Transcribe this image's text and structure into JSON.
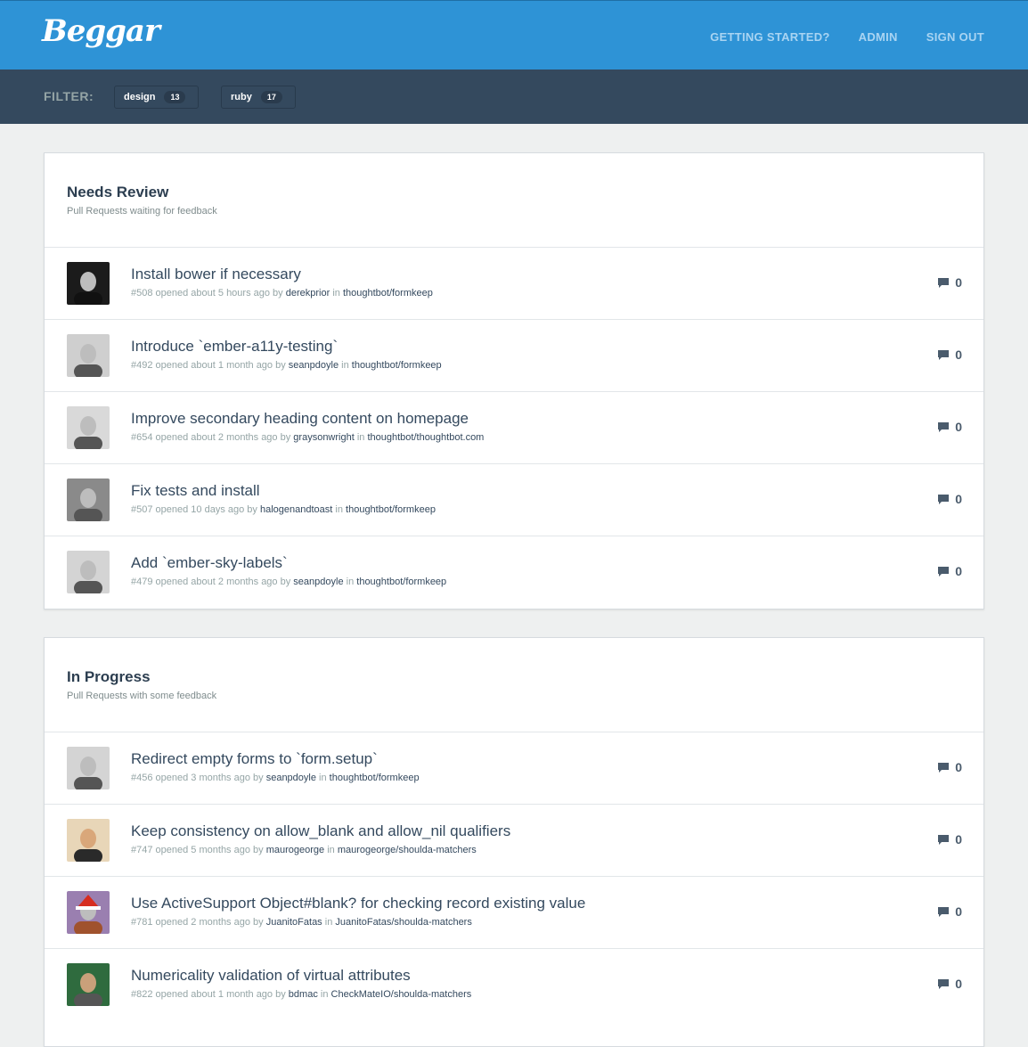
{
  "header": {
    "logo": "Beggar",
    "nav": [
      "GETTING STARTED?",
      "ADMIN",
      "SIGN OUT"
    ]
  },
  "filter": {
    "label": "FILTER:",
    "tags": [
      {
        "name": "design",
        "count": "13"
      },
      {
        "name": "ruby",
        "count": "17"
      }
    ]
  },
  "sections": [
    {
      "title": "Needs Review",
      "subtitle": "Pull Requests waiting for feedback",
      "items": [
        {
          "title": "Install bower if necessary",
          "number": "#508",
          "opened": "opened about 5 hours ago by",
          "author": "derekprior",
          "in": "in",
          "repo": "thoughtbot/formkeep",
          "comments": "0"
        },
        {
          "title": "Introduce `ember-a11y-testing`",
          "number": "#492",
          "opened": "opened about 1 month ago by",
          "author": "seanpdoyle",
          "in": "in",
          "repo": "thoughtbot/formkeep",
          "comments": "0"
        },
        {
          "title": "Improve secondary heading content on homepage",
          "number": "#654",
          "opened": "opened about 2 months ago by",
          "author": "graysonwright",
          "in": "in",
          "repo": "thoughtbot/thoughtbot.com",
          "comments": "0"
        },
        {
          "title": "Fix tests and install",
          "number": "#507",
          "opened": "opened 10 days ago by",
          "author": "halogenandtoast",
          "in": "in",
          "repo": "thoughtbot/formkeep",
          "comments": "0"
        },
        {
          "title": "Add `ember-sky-labels`",
          "number": "#479",
          "opened": "opened about 2 months ago by",
          "author": "seanpdoyle",
          "in": "in",
          "repo": "thoughtbot/formkeep",
          "comments": "0"
        }
      ]
    },
    {
      "title": "In Progress",
      "subtitle": "Pull Requests with some feedback",
      "items": [
        {
          "title": "Redirect empty forms to `form.setup`",
          "number": "#456",
          "opened": "opened 3 months ago by",
          "author": "seanpdoyle",
          "in": "in",
          "repo": "thoughtbot/formkeep",
          "comments": "0"
        },
        {
          "title": "Keep consistency on allow_blank and allow_nil qualifiers",
          "number": "#747",
          "opened": "opened 5 months ago by",
          "author": "maurogeorge",
          "in": "in",
          "repo": "maurogeorge/shoulda-matchers",
          "comments": "0"
        },
        {
          "title": "Use ActiveSupport Object#blank? for checking record existing value",
          "number": "#781",
          "opened": "opened 2 months ago by",
          "author": "JuanitoFatas",
          "in": "in",
          "repo": "JuanitoFatas/shoulda-matchers",
          "comments": "0"
        },
        {
          "title": "Numericality validation of virtual attributes",
          "number": "#822",
          "opened": "opened about 1 month ago by",
          "author": "bdmac",
          "in": "in",
          "repo": "CheckMateIO/shoulda-matchers",
          "comments": "0"
        }
      ]
    }
  ],
  "icons": {
    "comment": "comment-icon"
  },
  "colors": {
    "header": "#2e93d6",
    "filterbar": "#34495e",
    "background": "#eef0f0"
  }
}
